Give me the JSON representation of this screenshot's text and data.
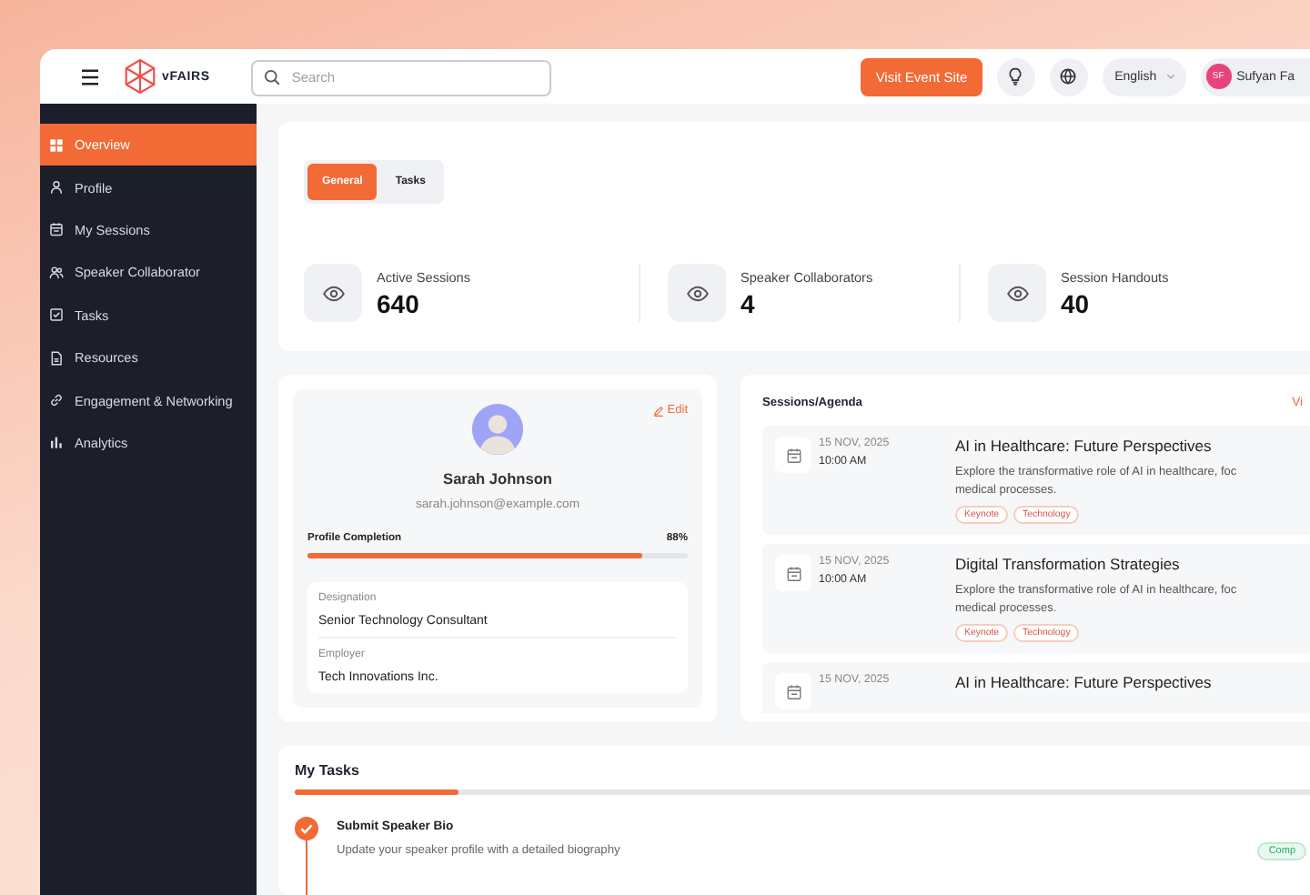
{
  "header": {
    "logo_text": "vFAIRS",
    "search": {
      "placeholder": "Search"
    },
    "visit_button": "Visit Event Site",
    "language": "English",
    "user": {
      "initials": "SF",
      "name": "Sufyan Fa"
    }
  },
  "sidebar": {
    "items": [
      {
        "label": "Overview",
        "selected": true
      },
      {
        "label": "Profile",
        "selected": false
      },
      {
        "label": "My Sessions",
        "selected": false
      },
      {
        "label": "Speaker Collaborator",
        "selected": false
      },
      {
        "label": "Tasks",
        "selected": false
      },
      {
        "label": "Resources",
        "selected": false
      },
      {
        "label": "Engagement & Networking",
        "selected": false
      },
      {
        "label": "Analytics",
        "selected": false
      }
    ]
  },
  "overview": {
    "tabs": [
      {
        "label": "General",
        "selected": true
      },
      {
        "label": "Tasks",
        "selected": false
      }
    ],
    "stats": [
      {
        "label": "Active Sessions",
        "value": "640"
      },
      {
        "label": "Speaker Collaborators",
        "value": "4"
      },
      {
        "label": "Session Handouts",
        "value": "40"
      }
    ]
  },
  "profile": {
    "edit": "Edit",
    "name": "Sarah Johnson",
    "email": "sarah.johnson@example.com",
    "completion_label": "Profile Completion",
    "completion_text": "88%",
    "level": 0.88,
    "details": [
      {
        "label": "Designation",
        "value": "Senior Technology Consultant"
      },
      {
        "label": "Employer",
        "value": "Tech Innovations Inc."
      }
    ]
  },
  "sessions": {
    "title": "Sessions/Agenda",
    "link": "Vi",
    "items": [
      {
        "date": "15 NOV, 2025",
        "time": "10:00 AM",
        "title": "AI in Healthcare: Future Perspectives",
        "description": [
          "Explore the transformative role of AI in healthcare, foc",
          "medical processes."
        ],
        "tags": [
          "Keynote",
          "Technology"
        ]
      },
      {
        "date": "15 NOV, 2025",
        "time": "10:00 AM",
        "title": "Digital Transformation Strategies",
        "description": [
          "Explore the transformative role of AI in healthcare, foc",
          "medical processes."
        ],
        "tags": [
          "Keynote",
          "Technology"
        ]
      },
      {
        "date": "15 NOV, 2025",
        "title": "AI in Healthcare: Future Perspectives"
      }
    ]
  },
  "tasks": {
    "title": "My Tasks",
    "level": 0.15,
    "items": [
      {
        "title": "Submit Speaker Bio",
        "description": "Update your speaker profile with a detailed biography",
        "completed": true,
        "status": "Comp"
      }
    ]
  }
}
